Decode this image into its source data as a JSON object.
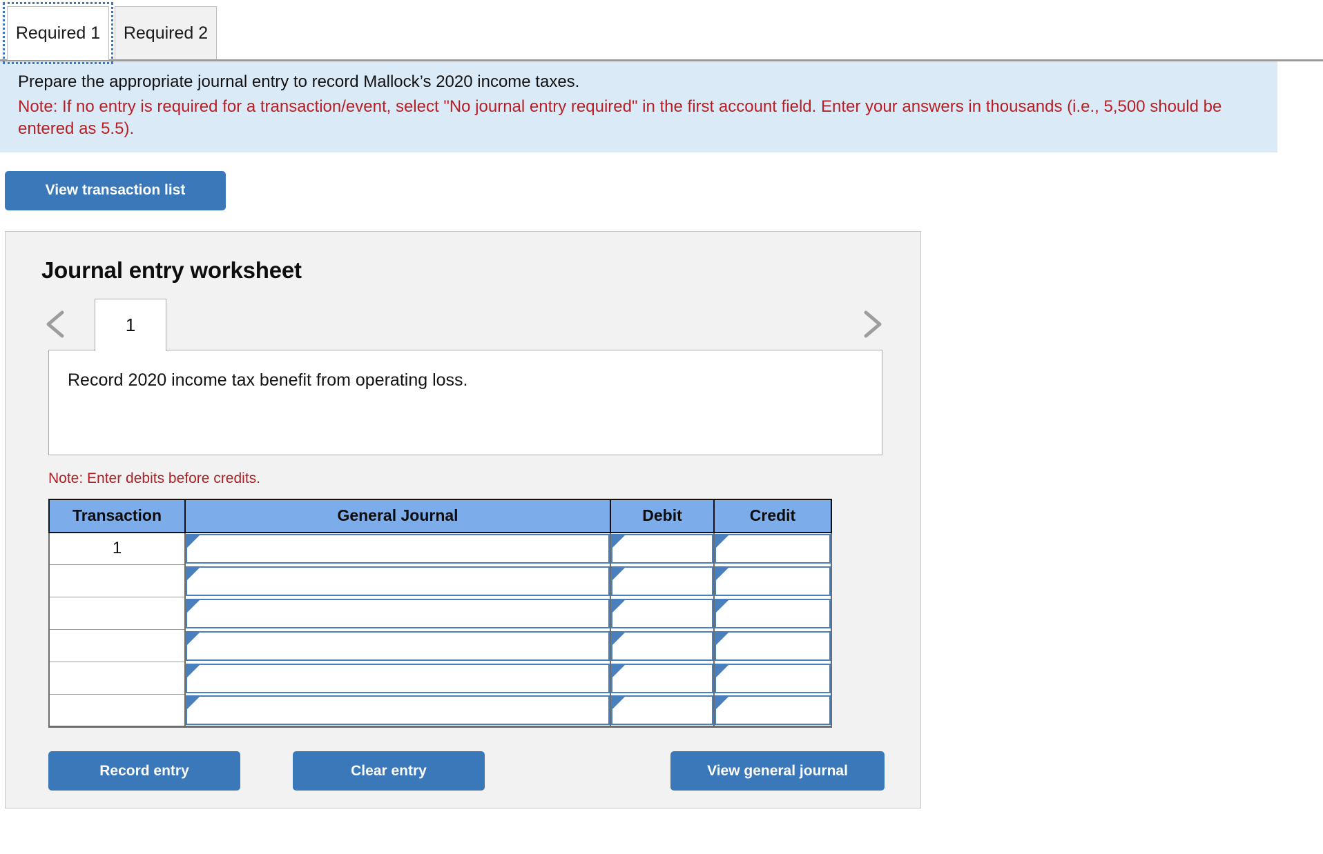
{
  "tabs": [
    {
      "label": "Required 1",
      "active": true
    },
    {
      "label": "Required 2",
      "active": false
    }
  ],
  "instruction": {
    "main": "Prepare the appropriate journal entry to record Mallock’s 2020 income taxes.",
    "note": "Note: If no entry is required for a transaction/event, select \"No journal entry required\" in the first account field. Enter your answers in thousands (i.e., 5,500 should be entered as 5.5)."
  },
  "toolbar": {
    "view_transaction_list_label": "View transaction list"
  },
  "worksheet": {
    "title": "Journal entry worksheet",
    "pager": {
      "prev_icon": "chevron-left-icon",
      "next_icon": "chevron-right-icon",
      "current_page": "1"
    },
    "description": "Record 2020 income tax benefit from operating loss.",
    "debit_note": "Note: Enter debits before credits.",
    "table": {
      "headers": [
        "Transaction",
        "General Journal",
        "Debit",
        "Credit"
      ],
      "rows": [
        {
          "transaction": "1",
          "general_journal": "",
          "debit": "",
          "credit": ""
        },
        {
          "transaction": "",
          "general_journal": "",
          "debit": "",
          "credit": ""
        },
        {
          "transaction": "",
          "general_journal": "",
          "debit": "",
          "credit": ""
        },
        {
          "transaction": "",
          "general_journal": "",
          "debit": "",
          "credit": ""
        },
        {
          "transaction": "",
          "general_journal": "",
          "debit": "",
          "credit": ""
        },
        {
          "transaction": "",
          "general_journal": "",
          "debit": "",
          "credit": ""
        }
      ]
    },
    "footer": {
      "record_entry_label": "Record entry",
      "clear_entry_label": "Clear entry",
      "view_general_journal_label": "View general journal"
    }
  },
  "colors": {
    "button_blue": "#3a78ba",
    "banner_blue": "#dbeaf7",
    "note_red": "#b81f24",
    "table_header_blue": "#7cadea",
    "input_border_blue": "#4a7fbd",
    "panel_gray": "#f2f2f2"
  }
}
